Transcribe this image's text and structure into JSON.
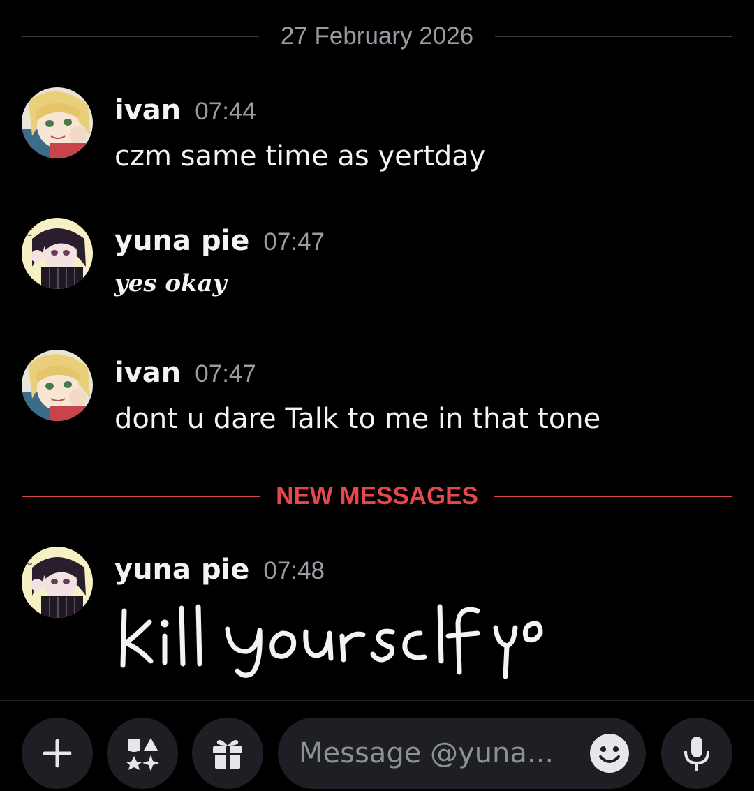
{
  "date_divider": "27 February 2026",
  "new_messages_label": "NEW MESSAGES",
  "messages": [
    {
      "author": "ivan",
      "time": "07:44",
      "content": "czm same time as yertday",
      "avatar_icon": "blonde-anime-avatar"
    },
    {
      "author": "yuna pie",
      "time": "07:47",
      "content": "yes okay",
      "avatar_icon": "dark-hair-anime-avatar"
    },
    {
      "author": "ivan",
      "time": "07:47",
      "content": "dont u dare Talk to me in that tone",
      "avatar_icon": "blonde-anime-avatar"
    },
    {
      "author": "yuna pie",
      "time": "07:48",
      "content": "kill yourself yo",
      "content_type": "handwritten-image",
      "avatar_icon": "dark-hair-anime-avatar"
    }
  ],
  "composer": {
    "placeholder": "Message @yuna...",
    "buttons": [
      "plus-icon",
      "apps-icon",
      "gift-icon",
      "emoji-icon",
      "microphone-icon"
    ]
  },
  "colors": {
    "background": "#000000",
    "text": "#f2f3f5",
    "muted": "#9a9ca3",
    "new_messages": "#e6474a",
    "button_bg": "#1e1f24"
  }
}
